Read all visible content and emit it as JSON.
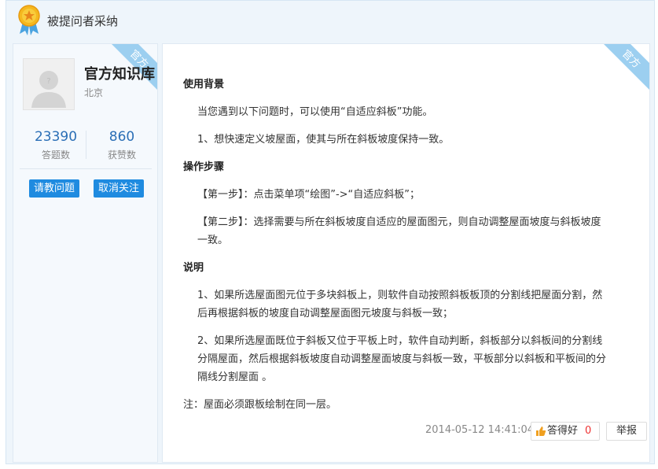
{
  "header": {
    "title": "被提问者采纳",
    "medal_icon": "medal-icon"
  },
  "badge": {
    "label": "官方",
    "color": "#9ccff0"
  },
  "user": {
    "name": "官方知识库",
    "location": "北京",
    "stats": [
      {
        "value": "23390",
        "label": "答题数"
      },
      {
        "value": "860",
        "label": "获赞数"
      }
    ],
    "ask_button": "请教问题",
    "unfollow_button": "取消关注"
  },
  "answer": {
    "sections": {
      "bg_title": "使用背景",
      "bg_p1": "当您遇到以下问题时，可以使用“自适应斜板”功能。",
      "bg_p2": "1、想快速定义坡屋面，使其与所在斜板坡度保持一致。",
      "steps_title": "操作步骤",
      "step1": "【第一步】：点击菜单项“绘图”->“自适应斜板”；",
      "step2": "【第二步】：选择需要与所在斜板坡度自适应的屋面图元，则自动调整屋面坡度与斜板坡度一致。",
      "note_title": "说明",
      "note1": "1、如果所选屋面图元位于多块斜板上，则软件自动按照斜板板顶的分割线把屋面分割，然后再根据斜板的坡度自动调整屋面图元坡度与斜板一致；",
      "note2": "2、如果所选屋面既位于斜板又位于平板上时，软件自动判断，斜板部分以斜板间的分割线分隔屋面，然后根据斜板坡度自动调整屋面坡度与斜板一致，平板部分以斜板和平板间的分隔线分割屋面 。",
      "footnote": "注：屋面必须跟板绘制在同一层。"
    },
    "timestamp": "2014-05-12 14:41:04",
    "good_label": "答得好",
    "good_count": "0",
    "report_label": "举报"
  }
}
